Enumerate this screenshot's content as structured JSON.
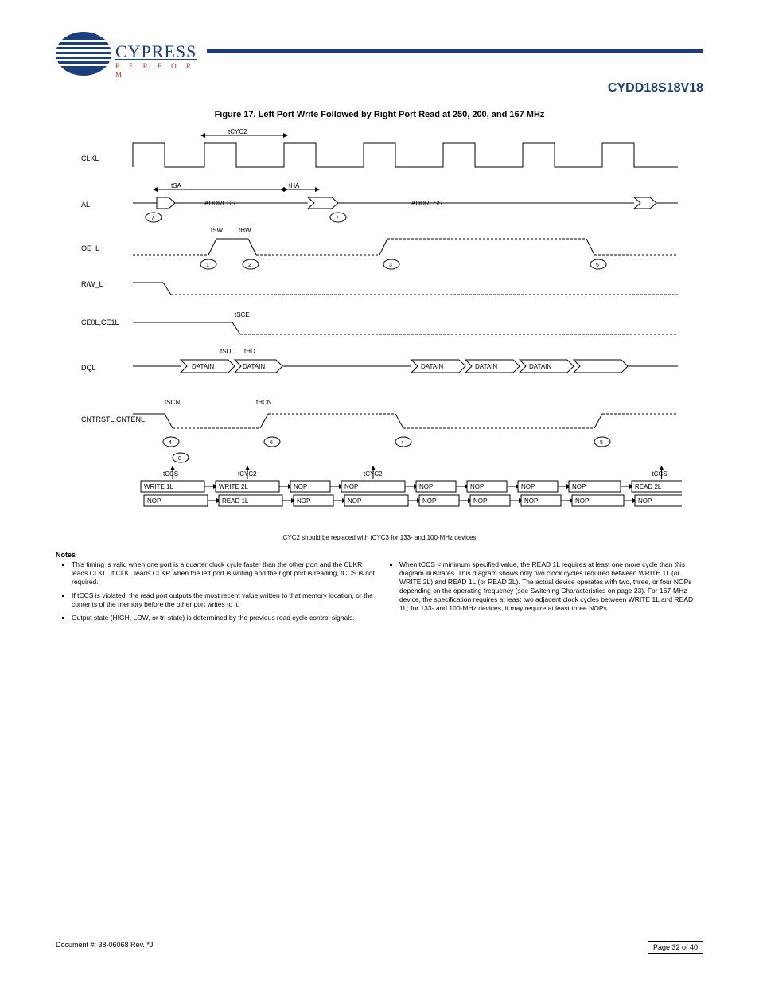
{
  "header": {
    "brand": "CYPRESS",
    "tagline": "P E R F O R M",
    "part_number": "CYDD18S18V18"
  },
  "figure": {
    "number": "Figure 17.",
    "title": "Left Port Write Followed by Right Port Read at 250, 200, and 167 MHz",
    "signals": [
      {
        "label": "CLKL"
      },
      {
        "label": "AL",
        "bus": [
          "ADDRESS",
          "ADDRESS"
        ]
      },
      {
        "label": "OE_L",
        "annot": [
          "1",
          "2",
          "3",
          "5"
        ]
      },
      {
        "label": "R/W_L"
      },
      {
        "label": "CE0L,CE1L"
      },
      {
        "label": "DQL",
        "bus": [
          "DATAIN",
          "DATAIN",
          "DATAIN",
          "DATAIN",
          "DATAIN"
        ]
      },
      {
        "label": "CNTRSTL,CNTENL",
        "annot": [
          "4",
          "6",
          "4",
          "5"
        ]
      }
    ],
    "timing_params": [
      "tCYC2",
      "tSA",
      "tHA",
      "tSW",
      "tHW",
      "tSCE",
      "tSD",
      "tHD",
      "tSCN",
      "tHCN"
    ],
    "sequence_top": [
      "tCCS",
      "tCYC2",
      "",
      "tCYC2",
      "",
      "",
      "",
      "",
      "tCCS"
    ],
    "sequence_bot": [
      "WRITE 1L",
      "WRITE 2L",
      "NOP",
      "NOP",
      "NOP",
      "NOP",
      "NOP",
      "NOP",
      "READ 2L"
    ],
    "sequence_bot2": [
      "NOP",
      "READ 1L",
      "NOP",
      "NOP",
      "NOP",
      "NOP",
      "NOP",
      "NOP",
      "NOP"
    ],
    "foot_small": "tCYC2 should be replaced with tCYC3 for 133- and 100-MHz devices."
  },
  "notes": {
    "heading": "Notes",
    "items": [
      "This timing is valid when one port is a quarter clock cycle faster than the other port and the CLKR leads CLKL. If CLKL leads CLKR when the left port is writing and the right port is reading, tCCS is not required.",
      "If tCCS is violated, the read port outputs the most recent value written to that memory location, or the contents of the memory before the other port writes to it.",
      "Output state (HIGH, LOW, or tri-state) is determined by the previous read cycle control signals.",
      "When tCCS < minimum specified value, the READ 1L requires at least one more cycle than this diagram illustrates. This diagram shows only two clock cycles required between WRITE 1L (or WRITE 2L) and READ 1L (or READ 2L). The actual device operates with two, three, or four NOPs depending on the operating frequency (see Switching Characteristics on page 23). For 167-MHz device, the specification requires at least two adjacent clock cycles between WRITE 1L and READ 1L; for 133- and 100-MHz devices, it may require at least three NOPs."
    ]
  },
  "footer": {
    "left": "Document #: 38-06068 Rev. *J",
    "right": "Page 32 of 40"
  },
  "chart_data": {
    "type": "timing-diagram",
    "description": "Digital timing diagram: left-port write followed by right-port read (250/200/167 MHz)",
    "clock": {
      "name": "CLKL",
      "cycles_shown": 7,
      "period_label": "tCYC2"
    },
    "traces": [
      {
        "name": "AL",
        "kind": "bus",
        "events": [
          {
            "at": 0.5,
            "value": "ADDRESS"
          },
          {
            "at": 2.4,
            "value": "ADDRESS"
          }
        ],
        "setup": "tSA",
        "hold": "tHA"
      },
      {
        "name": "OE_L",
        "kind": "signal",
        "events": [
          {
            "at": 1.2,
            "value": "low→high annotate 1"
          },
          {
            "at": 1.6,
            "value": "high→low annotate 2"
          },
          {
            "at": 3.0,
            "value": "annotate 3"
          },
          {
            "at": 5.0,
            "value": "annotate 5"
          }
        ],
        "setup": "tSW",
        "hold": "tHW"
      },
      {
        "name": "R/W_L",
        "kind": "signal",
        "events": [
          {
            "at": 0.7,
            "value": "high→low"
          }
        ]
      },
      {
        "name": "CE0L,CE1L",
        "kind": "signal",
        "events": [
          {
            "at": 1.5,
            "value": "low"
          }
        ],
        "setup": "tSCE"
      },
      {
        "name": "DQL",
        "kind": "bus",
        "events": [
          {
            "at": 1.2,
            "value": "DATAIN"
          },
          {
            "at": 1.8,
            "value": "DATAIN"
          },
          {
            "at": 3.2,
            "value": "DATAIN"
          },
          {
            "at": 3.9,
            "value": "DATAIN"
          },
          {
            "at": 4.6,
            "value": "DATAIN"
          }
        ],
        "setup": "tSD",
        "hold": "tHD"
      },
      {
        "name": "CNTRSTL,CNTENL",
        "kind": "signal",
        "events": [
          {
            "at": 1.0,
            "value": "low annotate 4"
          },
          {
            "at": 2.0,
            "value": "high annotate 6"
          },
          {
            "at": 3.0,
            "value": "low annotate 4"
          },
          {
            "at": 5.0,
            "value": "high annotate 5"
          }
        ],
        "setup": "tSCN",
        "hold": "tHCN"
      }
    ],
    "sequence_boxes": [
      [
        "tCCS",
        "tCYC2",
        "",
        "tCYC2",
        "",
        "",
        "",
        "",
        "tCCS"
      ],
      [
        "WRITE 1L",
        "WRITE 2L",
        "NOP",
        "NOP",
        "NOP",
        "NOP",
        "NOP",
        "NOP",
        "READ 2L"
      ],
      [
        "NOP",
        "READ 1L",
        "NOP",
        "NOP",
        "NOP",
        "NOP",
        "NOP",
        "NOP",
        "NOP"
      ]
    ]
  }
}
